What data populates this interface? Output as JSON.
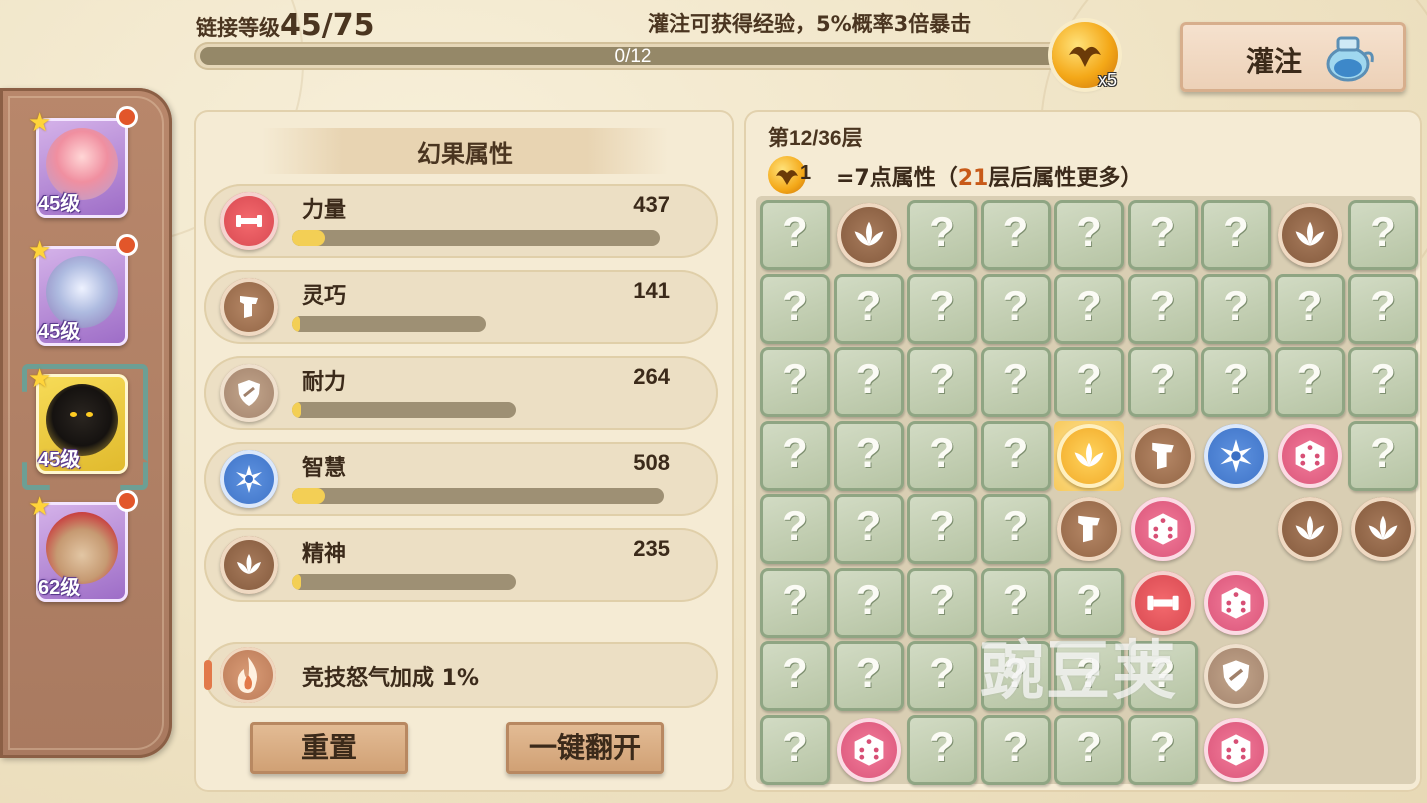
{
  "header": {
    "link_level_label": "链接等级",
    "link_level_value": "45/75",
    "infuse_hint": "灌注可获得经验，5%概率3倍暴击",
    "exp_progress_text": "0/12",
    "exp_progress_fraction": 0,
    "fruit_count": "x5",
    "infuse_button_label": "灌注"
  },
  "sidebar": {
    "characters": [
      {
        "level": "45级",
        "frame": "purple",
        "selected": false,
        "has_notification": true,
        "icon": "pink-hair-girl-portrait"
      },
      {
        "level": "45级",
        "frame": "purple",
        "selected": false,
        "has_notification": true,
        "icon": "sheep-creature-portrait"
      },
      {
        "level": "45级",
        "frame": "gold",
        "selected": true,
        "has_notification": false,
        "icon": "hooded-shadow-portrait"
      },
      {
        "level": "62级",
        "frame": "purple",
        "selected": false,
        "has_notification": true,
        "icon": "bear-red-hat-portrait"
      }
    ]
  },
  "attributes": {
    "title": "幻果属性",
    "items": [
      {
        "name": "力量",
        "value": "437",
        "fill_fraction": 0.09,
        "icon": "dumbbell-icon",
        "kind": "power"
      },
      {
        "name": "灵巧",
        "value": "141",
        "fill_fraction": 0.04,
        "icon": "wing-boot-icon",
        "kind": "agility"
      },
      {
        "name": "耐力",
        "value": "264",
        "fill_fraction": 0.04,
        "icon": "shield-icon",
        "kind": "stamina"
      },
      {
        "name": "智慧",
        "value": "508",
        "fill_fraction": 0.09,
        "icon": "snowflake-icon",
        "kind": "wisdom"
      },
      {
        "name": "精神",
        "value": "235",
        "fill_fraction": 0.04,
        "icon": "lotus-icon",
        "kind": "spirit"
      }
    ],
    "bonus_text": "竞技怒气加成 1%",
    "reset_button": "重置",
    "flip_all_button": "一键翻开"
  },
  "grid": {
    "floor_prefix": "第",
    "floor_value": "12/36",
    "floor_suffix": "层",
    "rule_coin_count": "1",
    "rule_text_prefix": "=7点属性（",
    "rule_text_highlight": "21",
    "rule_text_suffix": "层后属性更多）",
    "question_mark": "?",
    "rows": [
      [
        "q",
        "spirit",
        "q",
        "q",
        "q",
        "q",
        "q",
        "spirit",
        "q"
      ],
      [
        "q",
        "q",
        "q",
        "q",
        "q",
        "q",
        "q",
        "q",
        "q"
      ],
      [
        "q",
        "q",
        "q",
        "q",
        "q",
        "q",
        "q",
        "q",
        "q"
      ],
      [
        "q",
        "q",
        "q",
        "q",
        "spirit-gold",
        "agility",
        "wisdom",
        "dice",
        "q"
      ],
      [
        "q",
        "q",
        "q",
        "q",
        "agility",
        "dice",
        "empty",
        "spirit",
        "spirit"
      ],
      [
        "q",
        "q",
        "q",
        "q",
        "q",
        "power",
        "dice",
        "empty",
        "empty"
      ],
      [
        "q",
        "q",
        "q",
        "q",
        "q",
        "q",
        "stamina",
        "empty",
        "empty"
      ],
      [
        "q",
        "dice",
        "q",
        "q",
        "q",
        "q",
        "dice",
        "empty",
        "empty"
      ]
    ]
  },
  "watermark": "豌豆荚",
  "colors": {
    "accent_highlight": "#c85a18",
    "progress_fill": "#f3cf55",
    "grid_tile": "#b5c3a3"
  }
}
